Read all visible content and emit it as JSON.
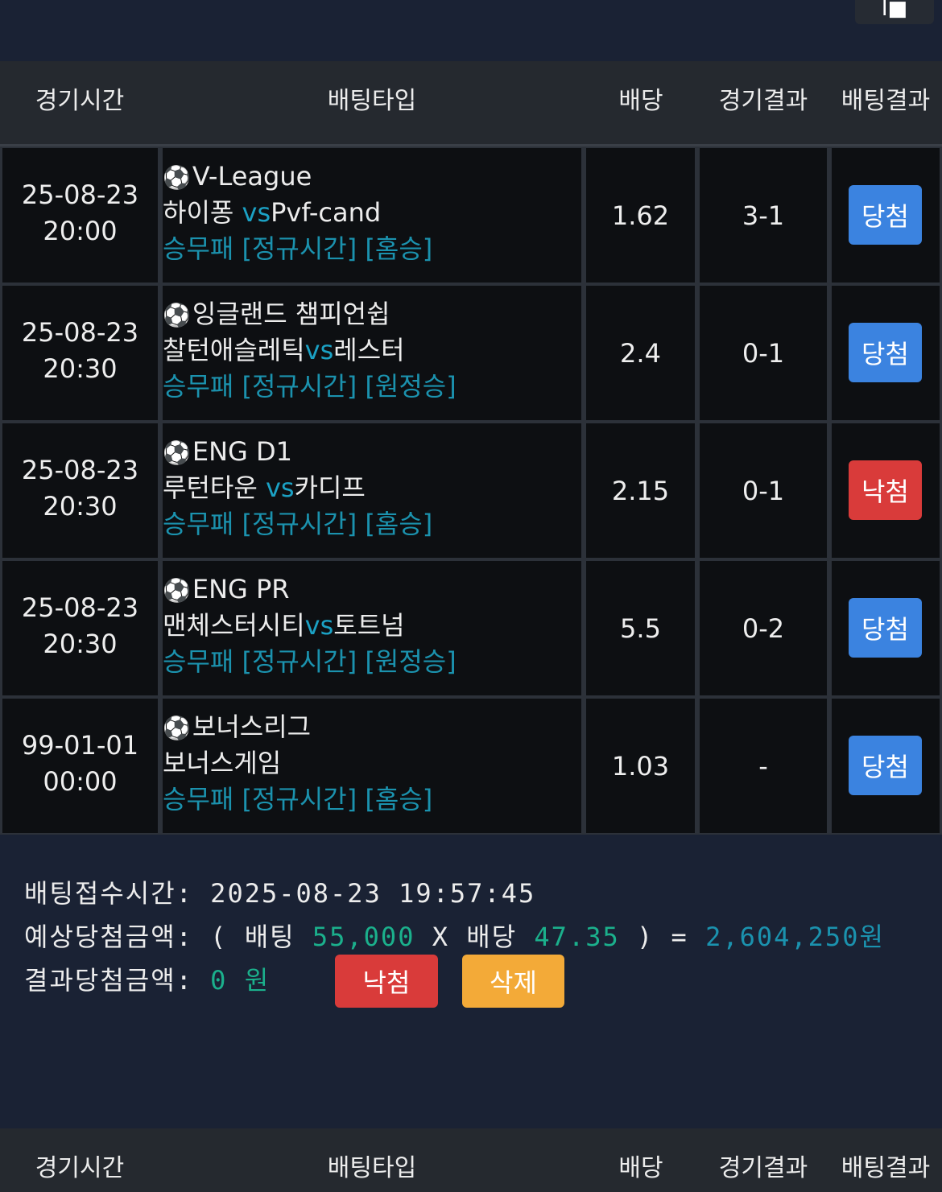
{
  "top_button": "Ⅰ■",
  "header": {
    "time": "경기시간",
    "type": "배팅타입",
    "odds": "배당",
    "result": "경기결과",
    "bet_result": "배팅결과"
  },
  "ball_icon": "⚽",
  "rows": [
    {
      "date": "25-08-23",
      "time": "20:00",
      "league": "V-League",
      "home": "하이퐁 ",
      "vs": "vs",
      "away": "Pvf-cand",
      "bet_type": "승무패 [정규시간] [홈승]",
      "odds": "1.62",
      "result": "3-1",
      "bet_result": "당첨",
      "status": "win"
    },
    {
      "date": "25-08-23",
      "time": "20:30",
      "league": "잉글랜드 챔피언쉽",
      "home": "찰턴애슬레틱",
      "vs": "vs",
      "away": "레스터",
      "bet_type": "승무패 [정규시간] [원정승]",
      "odds": "2.4",
      "result": "0-1",
      "bet_result": "당첨",
      "status": "win"
    },
    {
      "date": "25-08-23",
      "time": "20:30",
      "league": "ENG D1",
      "home": "루턴타운 ",
      "vs": "vs",
      "away": "카디프",
      "bet_type": "승무패 [정규시간] [홈승]",
      "odds": "2.15",
      "result": "0-1",
      "bet_result": "낙첨",
      "status": "lose"
    },
    {
      "date": "25-08-23",
      "time": "20:30",
      "league": "ENG PR",
      "home": "맨체스터시티",
      "vs": "vs",
      "away": "토트넘",
      "bet_type": "승무패 [정규시간] [원정승]",
      "odds": "5.5",
      "result": "0-2",
      "bet_result": "당첨",
      "status": "win"
    },
    {
      "date": "99-01-01",
      "time": "00:00",
      "league": "보너스리그",
      "home": "보너스게임",
      "vs": "",
      "away": "",
      "bet_type": "승무패 [정규시간] [홈승]",
      "odds": "1.03",
      "result": "-",
      "bet_result": "당첨",
      "status": "win"
    }
  ],
  "summary": {
    "received_label": "배팅접수시간: ",
    "received_value": "2025-08-23 19:57:45",
    "expected_label": "예상당첨금액: ( 배팅 ",
    "stake": "55,000",
    "times": " X 배당 ",
    "total_odds": "47.35",
    "equals": " ) = ",
    "expected_amount": "2,604,250원",
    "result_label": "결과당첨금액: ",
    "result_amount": "0 원"
  },
  "actions": {
    "lose": "낙첨",
    "delete": "삭제"
  },
  "colors": {
    "win": "#3b83e0",
    "lose": "#d93b3a",
    "delete": "#f3aa38",
    "teal": "#1b92ae",
    "green": "#1bb08c"
  }
}
